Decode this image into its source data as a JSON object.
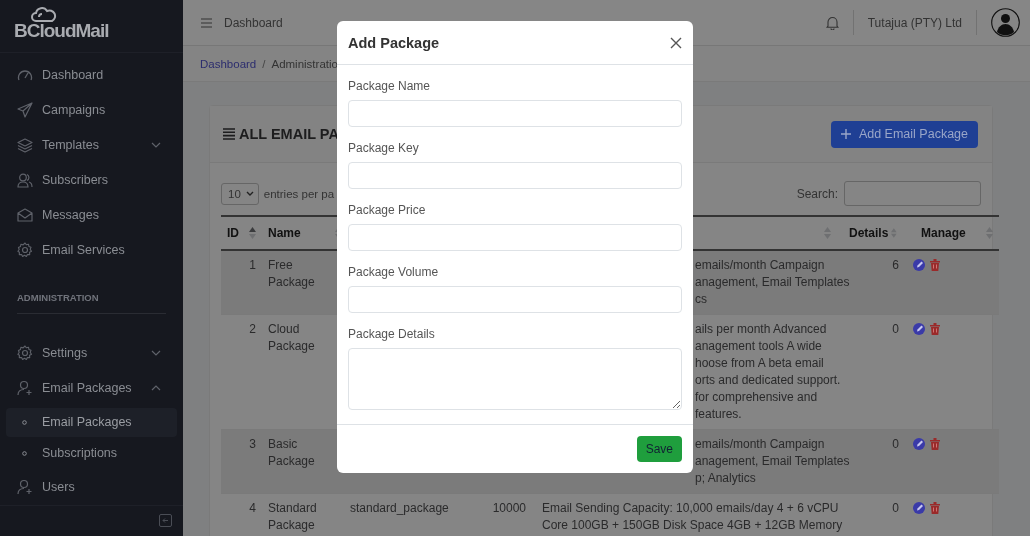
{
  "sidebar": {
    "logo": "BCloudMail",
    "items": [
      {
        "label": "Dashboard"
      },
      {
        "label": "Campaigns"
      },
      {
        "label": "Templates",
        "expanded": false
      },
      {
        "label": "Subscribers"
      },
      {
        "label": "Messages"
      },
      {
        "label": "Email Services"
      },
      {
        "kind": "section",
        "label": "ADMINISTRATION"
      },
      {
        "label": "Settings",
        "expanded": false
      },
      {
        "label": "Email Packages",
        "expanded": true,
        "children": [
          {
            "label": "Email Packages",
            "selected": true
          },
          {
            "label": "Subscriptions",
            "selected": false
          }
        ]
      },
      {
        "label": "Users"
      }
    ]
  },
  "topbar": {
    "title": "Dashboard",
    "company": "Tutajua (PTY) Ltd"
  },
  "breadcrumb": {
    "separator": "/",
    "items": [
      {
        "label": "Dashboard",
        "kind": "link"
      },
      {
        "label": "Administratio",
        "kind": "current"
      }
    ]
  },
  "card": {
    "title": "ALL EMAIL PA",
    "add_button": "Add Email Package",
    "page_size": "10",
    "page_size_label": "entries per pa",
    "search_label": "Search:"
  },
  "table": {
    "columns": [
      {
        "label": "ID",
        "sorted": true
      },
      {
        "label": "Name",
        "sorted": false
      },
      {
        "sorted": false
      },
      {
        "label": "Details",
        "sorted": false
      },
      {
        "label": "Manage",
        "sorted": false
      }
    ],
    "rows": [
      {
        "kind": "covered",
        "id": "1",
        "name": "Free Package",
        "description": [
          "emails/month Campaign",
          "anagement, Email Templates",
          "cs"
        ],
        "details": "6"
      },
      {
        "kind": "covered",
        "id": "2",
        "name": "Cloud Package",
        "description": [
          "ails per month Advanced",
          "anagement tools A wide",
          "hoose from A beta email",
          "orts and dedicated support.",
          "for comprehensive and",
          "features."
        ],
        "details": "0"
      },
      {
        "kind": "covered",
        "id": "3",
        "name": "Basic Package",
        "description": [
          "emails/month Campaign",
          "anagement, Email Templates",
          "p; Analytics"
        ],
        "details": "0"
      },
      {
        "kind": "full",
        "id": "4",
        "name": "Standard Package",
        "key": "standard_package",
        "volume": "10000",
        "description": [
          "Email Sending Capacity: 10,000 emails/day 4 + 6 vCPU",
          "Core 100GB + 150GB Disk Space 4GB + 12GB Memory"
        ],
        "details": "0"
      }
    ]
  },
  "modal": {
    "title": "Add Package",
    "fields": [
      {
        "label": "Package Name",
        "kind": "input"
      },
      {
        "label": "Package Key",
        "kind": "input"
      },
      {
        "label": "Package Price",
        "kind": "input"
      },
      {
        "label": "Package Volume",
        "kind": "input"
      },
      {
        "label": "Package Details",
        "kind": "textarea"
      }
    ],
    "save": "Save"
  }
}
